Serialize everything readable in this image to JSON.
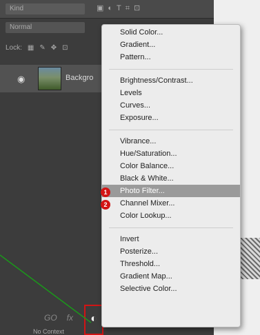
{
  "colors": {
    "panel": "#3c3c3c",
    "menu": "#ececec",
    "highlight": "#9a9a9a",
    "annotation_red": "#d21414",
    "annotation_green": "#1a9a1a"
  },
  "layers_panel": {
    "kind_filter": "Kind",
    "blend_mode": "Normal",
    "lock_label": "Lock:",
    "layer_name": "Backgro",
    "footer_fx": "fx",
    "footer_link": "GO",
    "bottom_text": "No Context"
  },
  "menu": {
    "items": [
      {
        "label": "Solid Color..."
      },
      {
        "label": "Gradient..."
      },
      {
        "label": "Pattern..."
      },
      {
        "label": "Brightness/Contrast..."
      },
      {
        "label": "Levels"
      },
      {
        "label": "Curves..."
      },
      {
        "label": "Exposure..."
      },
      {
        "label": "Vibrance..."
      },
      {
        "label": "Hue/Saturation..."
      },
      {
        "label": "Color Balance..."
      },
      {
        "label": "Black & White..."
      },
      {
        "label": "Photo Filter..."
      },
      {
        "label": "Channel Mixer..."
      },
      {
        "label": "Color Lookup..."
      },
      {
        "label": "Invert"
      },
      {
        "label": "Posterize..."
      },
      {
        "label": "Threshold..."
      },
      {
        "label": "Gradient Map..."
      },
      {
        "label": "Selective Color..."
      }
    ]
  },
  "annotations": {
    "badge_1": "1",
    "badge_2": "2"
  }
}
